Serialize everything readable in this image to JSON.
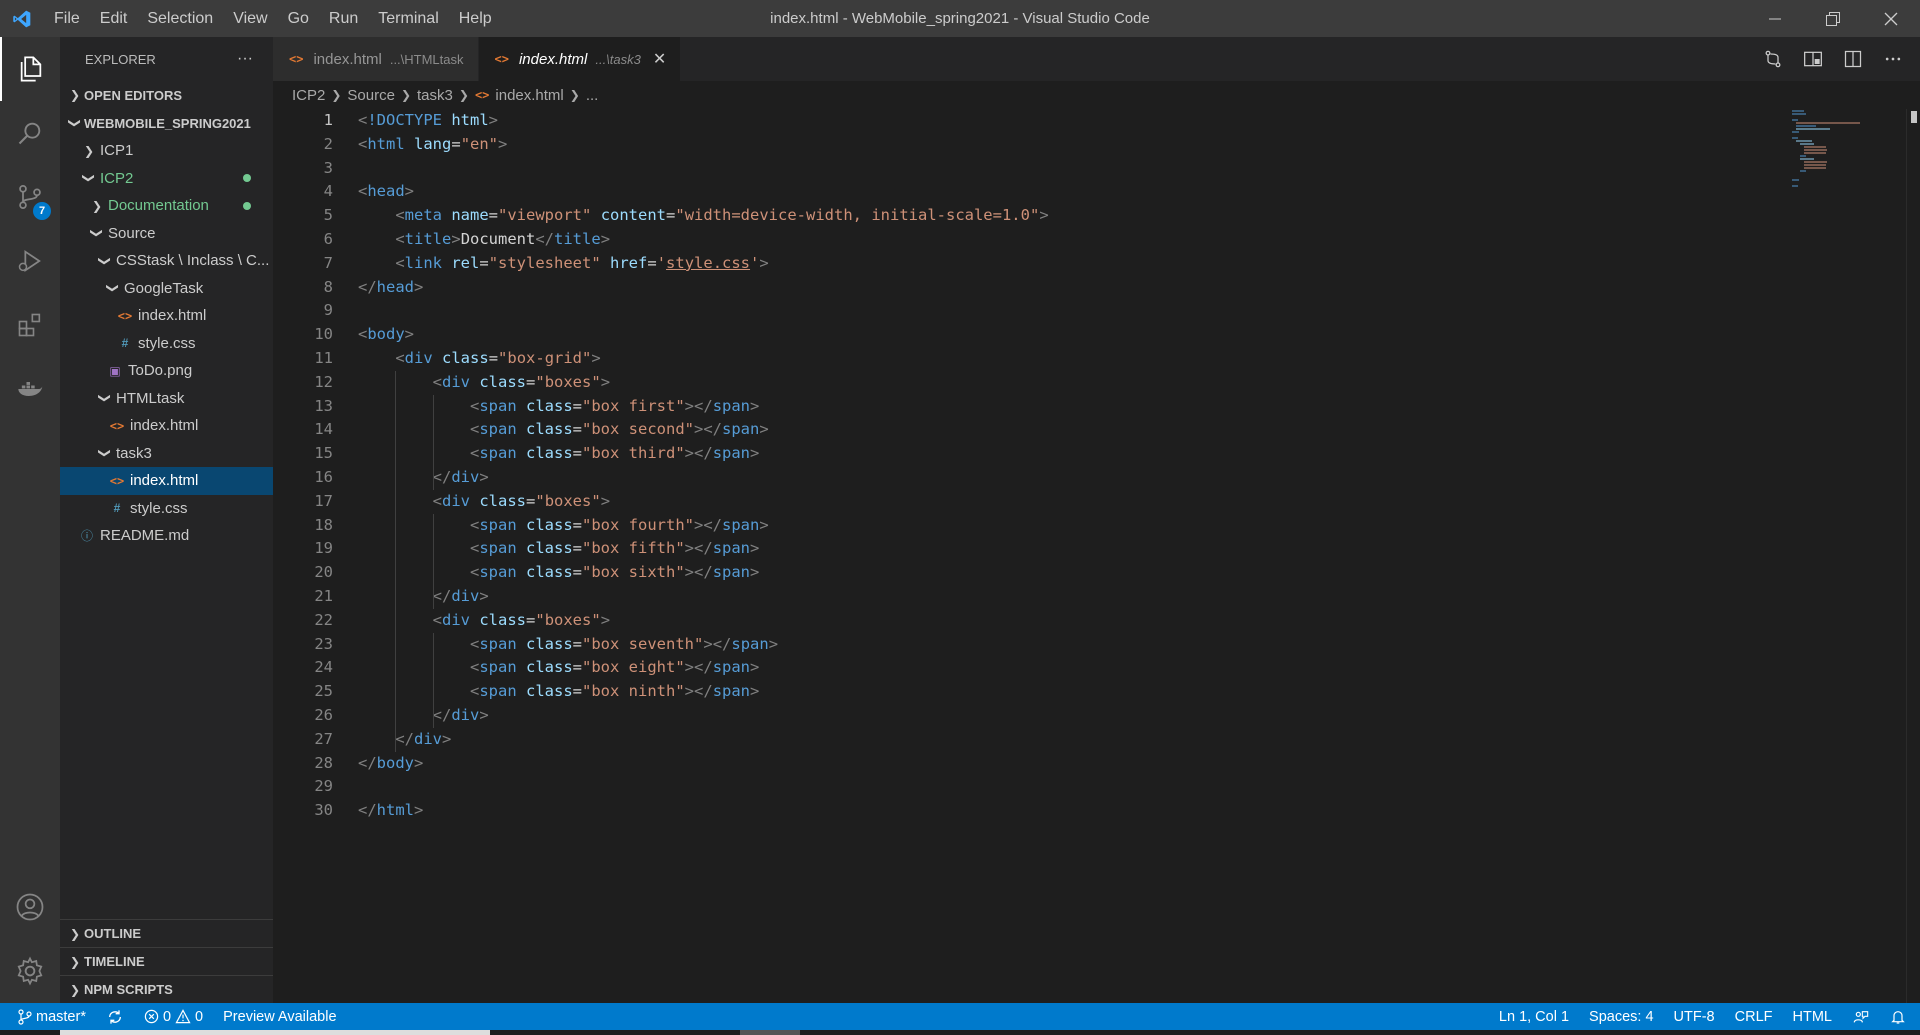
{
  "window": {
    "title": "index.html - WebMobile_spring2021 - Visual Studio Code",
    "menu": [
      "File",
      "Edit",
      "Selection",
      "View",
      "Go",
      "Run",
      "Terminal",
      "Help"
    ]
  },
  "activity_bar": {
    "items": [
      "explorer-icon",
      "search-icon",
      "source-control-icon",
      "run-debug-icon",
      "extensions-icon",
      "docker-icon"
    ],
    "source_control_badge": "7",
    "bottom": [
      "accounts-icon",
      "manage-gear-icon"
    ]
  },
  "sidebar": {
    "header": "EXPLORER",
    "more": "···",
    "sections": {
      "open_editors": "OPEN EDITORS",
      "workspace": "WEBMOBILE_SPRING2021",
      "outline": "OUTLINE",
      "timeline": "TIMELINE",
      "npm_scripts": "NPM SCRIPTS"
    },
    "tree": [
      {
        "label": "ICP1"
      },
      {
        "label": "ICP2"
      },
      {
        "label": "Documentation"
      },
      {
        "label": "Source"
      },
      {
        "label": "CSStask \\ Inclass \\ C..."
      },
      {
        "label": "GoogleTask"
      },
      {
        "label": "index.html"
      },
      {
        "label": "style.css"
      },
      {
        "label": "ToDo.png"
      },
      {
        "label": "HTMLtask"
      },
      {
        "label": "index.html"
      },
      {
        "label": "task3"
      },
      {
        "label": "index.html"
      },
      {
        "label": "style.css"
      },
      {
        "label": "README.md"
      }
    ]
  },
  "tabs": [
    {
      "label": "index.html",
      "desc": "...\\HTMLtask"
    },
    {
      "label": "index.html",
      "desc": "...\\task3",
      "close": "✕"
    }
  ],
  "breadcrumb": {
    "items": [
      "ICP2",
      "Source",
      "task3",
      "index.html",
      "..."
    ]
  },
  "editor": {
    "line_numbers": [
      "1",
      "2",
      "3",
      "4",
      "5",
      "6",
      "7",
      "8",
      "9",
      "10",
      "11",
      "12",
      "13",
      "14",
      "15",
      "16",
      "17",
      "18",
      "19",
      "20",
      "21",
      "22",
      "23",
      "24",
      "25",
      "26",
      "27",
      "28",
      "29",
      "30"
    ],
    "lines": [
      "<!DOCTYPE html>",
      "<html lang=\"en\">",
      "",
      "<head>",
      "    <meta name=\"viewport\" content=\"width=device-width, initial-scale=1.0\">",
      "    <title>Document</title>",
      "    <link rel=\"stylesheet\" href='style.css'>",
      "</head>",
      "",
      "<body>",
      "    <div class=\"box-grid\">",
      "        <div class=\"boxes\">",
      "            <span class=\"box first\"></span>",
      "            <span class=\"box second\"></span>",
      "            <span class=\"box third\"></span>",
      "        </div>",
      "        <div class=\"boxes\">",
      "            <span class=\"box fourth\"></span>",
      "            <span class=\"box fifth\"></span>",
      "            <span class=\"box sixth\"></span>",
      "        </div>",
      "        <div class=\"boxes\">",
      "            <span class=\"box seventh\"></span>",
      "            <span class=\"box eight\"></span>",
      "            <span class=\"box ninth\"></span>",
      "        </div>",
      "    </div>",
      "</body>",
      "",
      "</html>"
    ]
  },
  "statusbar": {
    "branch": "master*",
    "errors": "0",
    "warnings": "0",
    "preview": "Preview Available",
    "position": "Ln 1, Col 1",
    "spaces": "Spaces: 4",
    "encoding": "UTF-8",
    "eol": "CRLF",
    "language": "HTML"
  },
  "colors": {
    "accent": "#007acc",
    "selection": "#094771",
    "git_added": "#73c991",
    "html_icon": "#e37933",
    "css_icon": "#519aba"
  }
}
